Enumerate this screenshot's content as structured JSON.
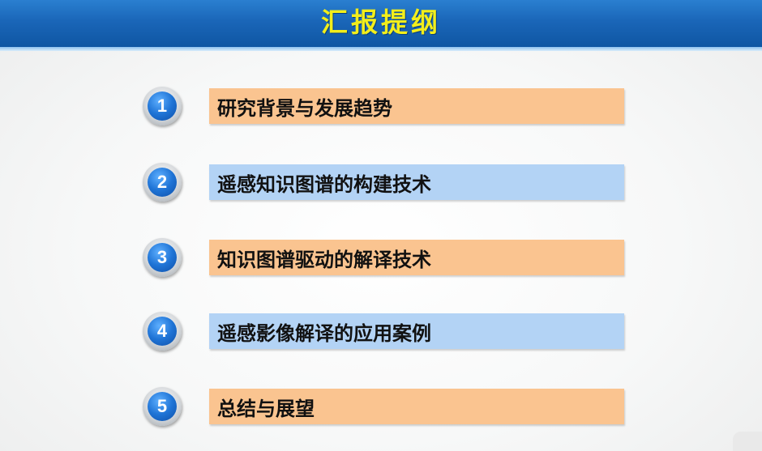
{
  "header": {
    "title": "汇报提纲"
  },
  "outline": {
    "items": [
      {
        "number": "1",
        "label": "研究背景与发展趋势",
        "color": "#fac490"
      },
      {
        "number": "2",
        "label": "遥感知识图谱的构建技术",
        "color": "#b3d3f5"
      },
      {
        "number": "3",
        "label": "知识图谱驱动的解译技术",
        "color": "#fac490"
      },
      {
        "number": "4",
        "label": "遥感影像解译的应用案例",
        "color": "#b3d3f5"
      },
      {
        "number": "5",
        "label": "总结与展望",
        "color": "#fac490"
      }
    ]
  },
  "colors": {
    "header_blue": "#1a66b8",
    "title_yellow": "#f2ee1b",
    "number_blue": "#1f74d6"
  }
}
